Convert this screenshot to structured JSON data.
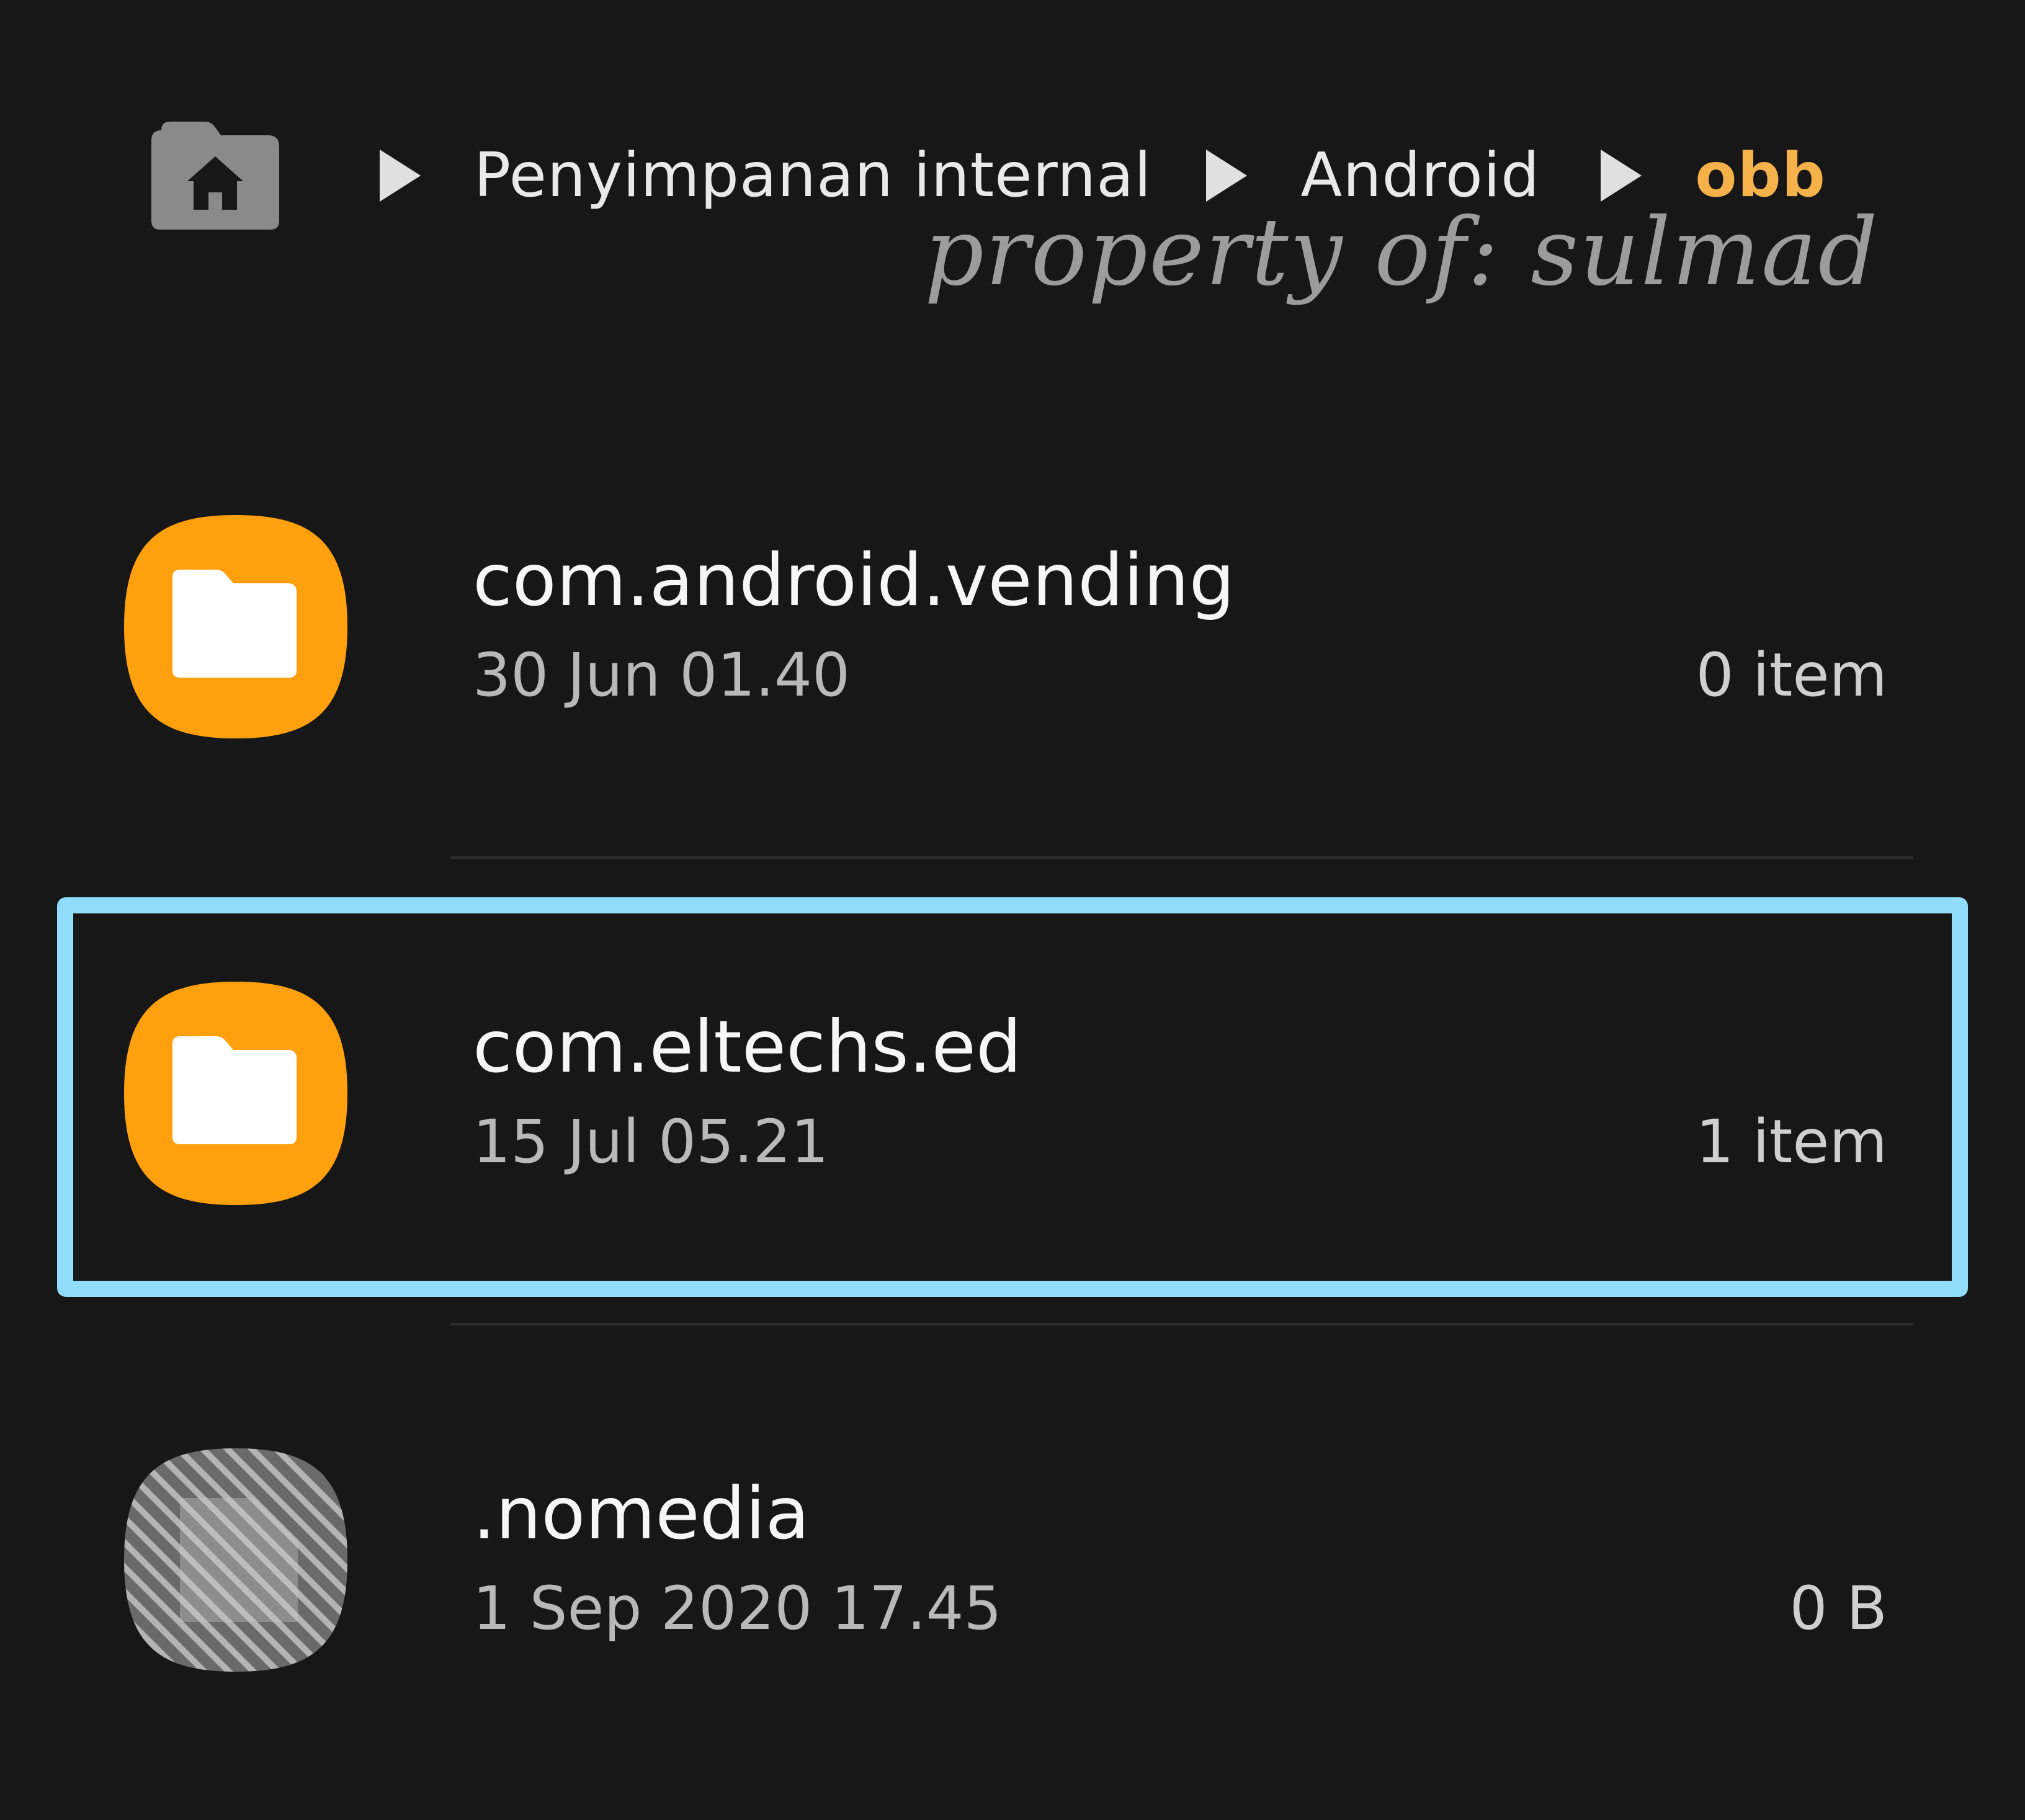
{
  "breadcrumb": {
    "home_icon": "home-folder-icon",
    "separator_icon": "triangle-right-icon",
    "items": [
      {
        "label": "Penyimpanan internal"
      },
      {
        "label": "Android"
      },
      {
        "label": "obb"
      }
    ],
    "current_color": "#f5b14a"
  },
  "watermark": "property of: sulmad",
  "files": [
    {
      "name": "com.android.vending",
      "date": "30 Jun 01.40",
      "size": "0 item",
      "icon": "folder-icon",
      "selected": false
    },
    {
      "name": "com.eltechs.ed",
      "date": "15 Jul 05.21",
      "size": "1 item",
      "icon": "folder-icon",
      "selected": true
    },
    {
      "name": ".nomedia",
      "date": "1 Sep 2020 17.45",
      "size": "0 B",
      "icon": "hidden-file-icon",
      "selected": false
    }
  ],
  "colors": {
    "background": "#171717",
    "folder": "#ffa10f",
    "highlight": "#8fdcfb"
  }
}
